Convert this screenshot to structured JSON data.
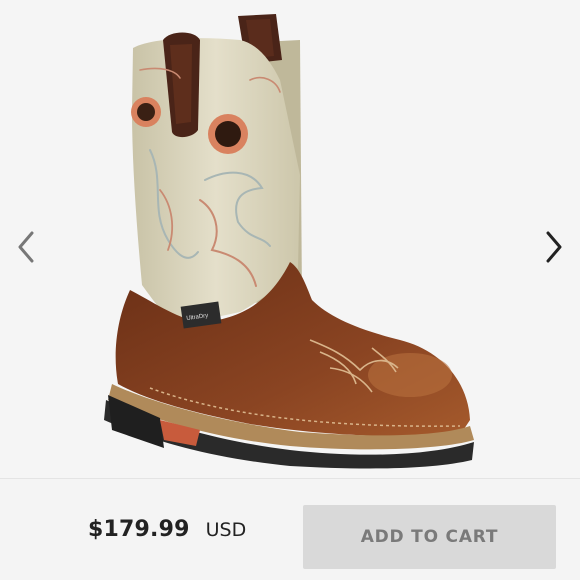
{
  "gallery": {
    "image_icon": "product-photo-boot",
    "prev_icon": "chevron-left-icon",
    "next_icon": "chevron-right-icon",
    "label_text": "UltraDry"
  },
  "purchase": {
    "price": "$179.99",
    "currency": "USD",
    "cart_label": "ADD TO CART"
  },
  "colors": {
    "background": "#f5f5f5",
    "button_bg": "#d9d9d9",
    "button_text": "#7a7a7a",
    "price_text": "#222222"
  }
}
